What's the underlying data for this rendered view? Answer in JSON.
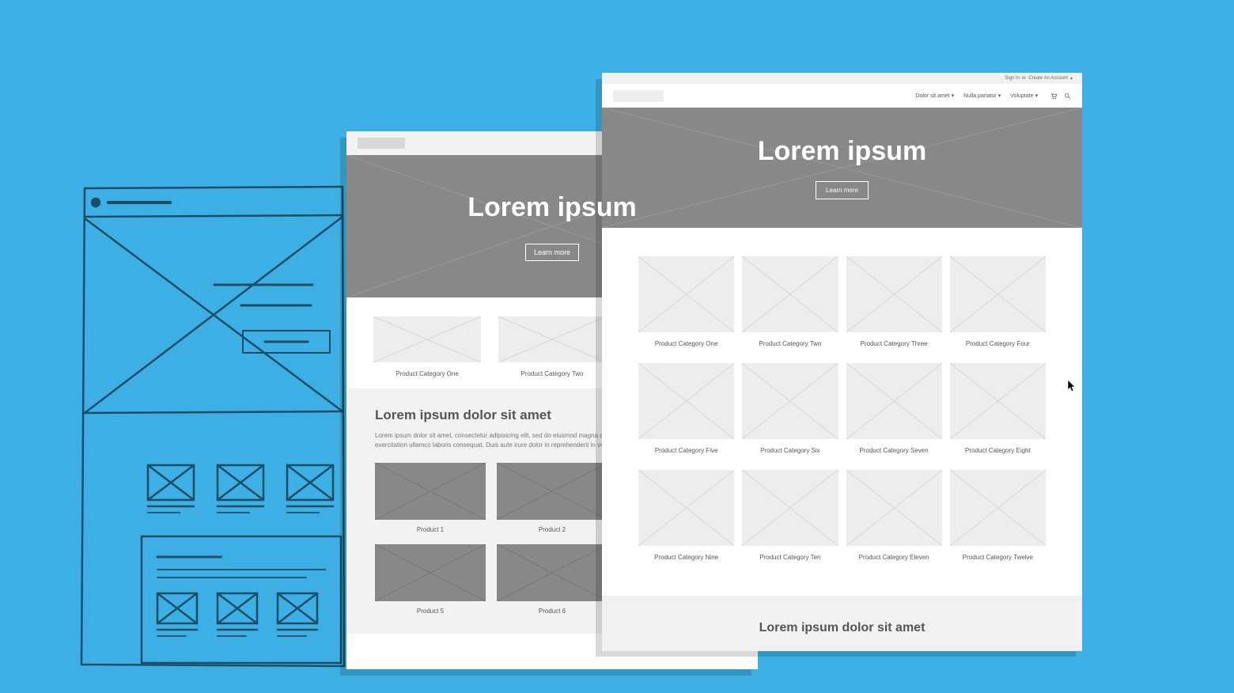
{
  "hi_wireframe": {
    "util_bar": {
      "signin": "Sign In",
      "or": "or",
      "create": "Create An Account"
    },
    "nav": {
      "items": [
        {
          "label": "Dolor sit amet"
        },
        {
          "label": "Nulla pariatur"
        },
        {
          "label": "Voluptate"
        }
      ]
    },
    "hero": {
      "title": "Lorem ipsum",
      "cta": "Learn more"
    },
    "categories": [
      {
        "label": "Product Category One"
      },
      {
        "label": "Product Category Two"
      },
      {
        "label": "Product Category Three"
      },
      {
        "label": "Product Category Four"
      },
      {
        "label": "Product Category Five"
      },
      {
        "label": "Product Category Six"
      },
      {
        "label": "Product Category Seven"
      },
      {
        "label": "Product Category Eight"
      },
      {
        "label": "Product Category Nine"
      },
      {
        "label": "Product Category Ten"
      },
      {
        "label": "Product Category Eleven"
      },
      {
        "label": "Product Category Twelve"
      }
    ],
    "bottom_title": "Lorem ipsum dolor sit amet"
  },
  "mid_wireframe": {
    "hero": {
      "title": "Lorem ipsum",
      "cta": "Learn more"
    },
    "categories": [
      {
        "label": "Product Category One"
      },
      {
        "label": "Product Category Two"
      },
      {
        "label": ""
      }
    ],
    "section": {
      "title": "Lorem ipsum dolor sit amet",
      "body": "Lorem ipsum dolor sit amet, consectetur adipisicing elit, sed do eiusmod magna aliqua. Ad minim veniam, quis nostrud exercitation ullamco laboris consequat. Duis aute irure dolor in reprehenderit in voluptate velit esse."
    },
    "products_row1": [
      {
        "label": "Product 1"
      },
      {
        "label": "Product 2"
      },
      {
        "label": ""
      }
    ],
    "products_row2": [
      {
        "label": "Product 5"
      },
      {
        "label": "Product 6"
      },
      {
        "label": ""
      }
    ]
  }
}
